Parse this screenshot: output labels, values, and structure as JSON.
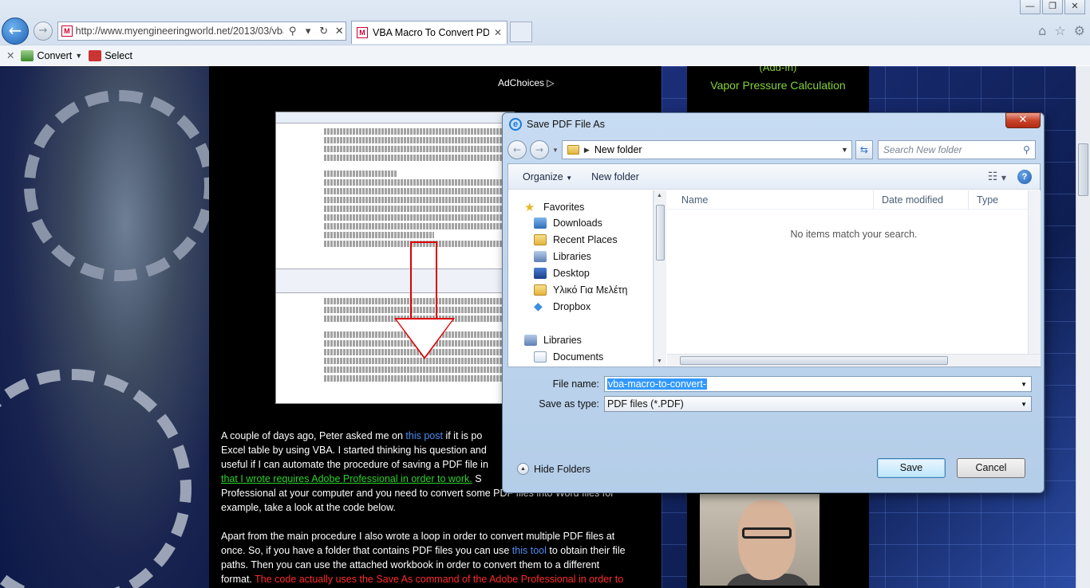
{
  "browser": {
    "url": "http://www.myengineeringworld.net/2013/03/vba-",
    "tab_title": "VBA Macro To Convert PDF...",
    "window_buttons": [
      "—",
      "❐",
      "✕"
    ],
    "commandbar": {
      "convert_label": "Convert",
      "select_label": "Select"
    }
  },
  "page": {
    "adchoices": "AdChoices ▷",
    "sidebar_top": "(Add-In)",
    "sidebar_title": "Vapor Pressure Calculation",
    "para1": {
      "t1": "A couple of days ago, Peter asked me on ",
      "l1": "this post",
      "t2": " if it is po",
      "t3": "Excel table by using VBA. I started thinking his question and",
      "t4": "useful if I can automate the procedure of saving a PDF file in",
      "g1": "that I wrote requires Adobe Professional in order to work.",
      "t5": " S",
      "t6": "Professional at your computer and you need to convert some PDF files into Word files for",
      "t7": "example, take a look at the code below."
    },
    "para2": {
      "t1": "Apart from the main procedure I also wrote a loop in order to convert multiple PDF files at",
      "t2": "once. So, if you have a folder that contains PDF files you can use ",
      "l1": "this tool",
      "t3": " to obtain their file",
      "t4": "paths. Then you can use the attached workbook in order to convert them to a different",
      "t5": "format. ",
      "r1": "The code actually uses the Save As command of the Adobe Professional in order to"
    }
  },
  "dialog": {
    "title": "Save PDF File As",
    "breadcrumb": "New folder",
    "search_placeholder": "Search New folder",
    "toolbar": {
      "organize": "Organize",
      "new_folder": "New folder"
    },
    "nav": [
      {
        "label": "Favorites",
        "icon": "star-icon"
      },
      {
        "label": "Downloads",
        "icon": "downloads-icon"
      },
      {
        "label": "Recent Places",
        "icon": "recent-places-icon"
      },
      {
        "label": "Libraries",
        "icon": "libraries-icon"
      },
      {
        "label": "Desktop",
        "icon": "desktop-icon"
      },
      {
        "label": "Υλικό Για Μελέτη",
        "icon": "folder-icon"
      },
      {
        "label": "Dropbox",
        "icon": "dropbox-icon"
      },
      {
        "label": "Libraries",
        "icon": "libraries-icon"
      },
      {
        "label": "Documents",
        "icon": "documents-icon"
      }
    ],
    "columns": {
      "name": "Name",
      "date": "Date modified",
      "type": "Type"
    },
    "empty_message": "No items match your search.",
    "file_name_label": "File name:",
    "file_name_value": "vba-macro-to-convert-",
    "save_type_label": "Save as type:",
    "save_type_value": "PDF files (*.PDF)",
    "hide_folders": "Hide Folders",
    "save": "Save",
    "cancel": "Cancel"
  }
}
